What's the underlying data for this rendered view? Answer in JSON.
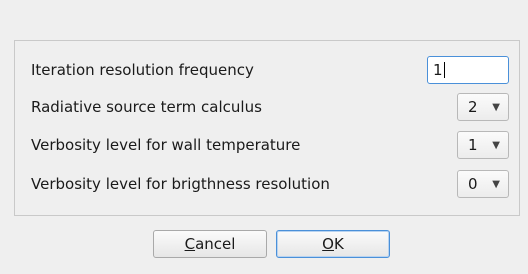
{
  "form": {
    "rows": [
      {
        "label": "Iteration resolution frequency",
        "value": "1"
      },
      {
        "label": "Radiative source term calculus",
        "value": "2"
      },
      {
        "label": "Verbosity level for wall temperature",
        "value": "1"
      },
      {
        "label": "Verbosity level for brigthness resolution",
        "value": "0"
      }
    ]
  },
  "buttons": {
    "cancel": {
      "mnemonic": "C",
      "rest": "ancel"
    },
    "ok": {
      "mnemonic": "O",
      "rest": "K"
    }
  },
  "icons": {
    "dropdown": "chevron-down-icon"
  }
}
